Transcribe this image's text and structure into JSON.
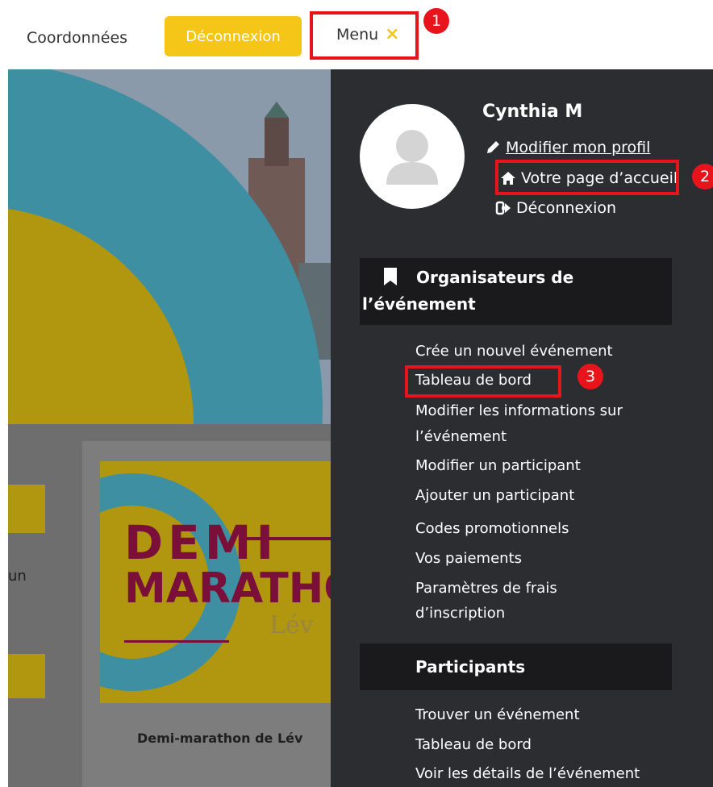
{
  "nav": {
    "coordonnees": "Coordonnées",
    "logout_button": "Déconnexion",
    "menu_label": "Menu",
    "menu_close": "×"
  },
  "badges": [
    "1",
    "2",
    "3"
  ],
  "profile": {
    "name": "Cynthia M",
    "edit_profile": "Modifier mon profil",
    "home_page": "Votre page d’accueil",
    "logout": "Déconnexion"
  },
  "organizers": {
    "title_line1": "Organisateurs de",
    "title_line2": "l’événement",
    "items": [
      "Crée un nouvel événement",
      "Tableau de bord",
      "Modifier les informations sur",
      "l’événement",
      "Modifier un participant",
      "Ajouter un participant",
      "Codes promotionnels",
      "Vos paiements",
      "Paramètres de frais",
      "d’inscription"
    ]
  },
  "participants": {
    "title": "Participants",
    "items": [
      "Trouver un événement",
      "Tableau de bord",
      "Voir les détails de l’événement"
    ]
  },
  "background": {
    "poster_demi": "DEMI",
    "poster_marathon": "MARATHO",
    "poster_lev": "Lév",
    "card_title": "Demi-marathon de Lév",
    "left_text": "un"
  },
  "colors": {
    "accent_yellow": "#f5c518",
    "highlight_red": "#e8141c",
    "panel_bg": "#2b2d31",
    "section_bg": "#1a1a1d"
  }
}
